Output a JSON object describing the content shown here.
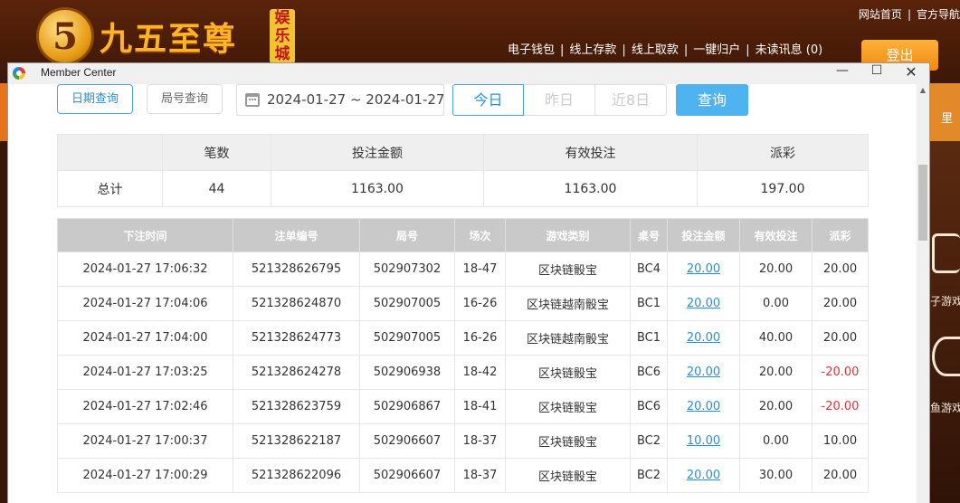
{
  "site": {
    "logo_glyph": "5",
    "logo_text": "九五至尊",
    "logo_sub": "娱乐城",
    "top_links": [
      "网站首页",
      "官方导航"
    ],
    "nav_links": [
      "电子钱包",
      "线上存款",
      "线上取款",
      "一键归户",
      "未读讯息 (0)"
    ],
    "logout_label": "登出",
    "right_labels": [
      "电子游戏",
      "捕鱼游戏"
    ],
    "right_top_text": "里"
  },
  "window": {
    "title": "Member Center",
    "controls": {
      "minimize": "—",
      "maximize": "☐",
      "close": "✕"
    }
  },
  "filter": {
    "tab_date": "日期查询",
    "tab_round": "局号查询",
    "date_range": "2024-01-27 ~ 2024-01-27",
    "quick": [
      "今日",
      "昨日",
      "近8日"
    ],
    "query_label": "查询"
  },
  "summary": {
    "headers": [
      "",
      "笔数",
      "投注金额",
      "有效投注",
      "派彩"
    ],
    "row": [
      "总计",
      "44",
      "1163.00",
      "1163.00",
      "197.00"
    ]
  },
  "bets": {
    "headers": [
      "下注时间",
      "注单编号",
      "局号",
      "场次",
      "游戏类别",
      "桌号",
      "投注金额",
      "有效投注",
      "派彩"
    ],
    "rows": [
      [
        "2024-01-27 17:06:32",
        "521328626795",
        "502907302",
        "18-47",
        "区块链骰宝",
        "BC4",
        "20.00",
        "20.00",
        "20.00"
      ],
      [
        "2024-01-27 17:04:06",
        "521328624870",
        "502907005",
        "16-26",
        "区块链越南骰宝",
        "BC1",
        "20.00",
        "0.00",
        "20.00"
      ],
      [
        "2024-01-27 17:04:00",
        "521328624773",
        "502907005",
        "16-26",
        "区块链越南骰宝",
        "BC1",
        "20.00",
        "40.00",
        "20.00"
      ],
      [
        "2024-01-27 17:03:25",
        "521328624278",
        "502906938",
        "18-42",
        "区块链骰宝",
        "BC6",
        "20.00",
        "20.00",
        "-20.00"
      ],
      [
        "2024-01-27 17:02:46",
        "521328623759",
        "502906867",
        "18-41",
        "区块链骰宝",
        "BC6",
        "20.00",
        "20.00",
        "-20.00"
      ],
      [
        "2024-01-27 17:00:37",
        "521328622187",
        "502906607",
        "18-37",
        "区块链骰宝",
        "BC2",
        "10.00",
        "0.00",
        "10.00"
      ],
      [
        "2024-01-27 17:00:29",
        "521328622096",
        "502906607",
        "18-37",
        "区块链骰宝",
        "BC2",
        "20.00",
        "30.00",
        "20.00"
      ]
    ]
  },
  "colors": {
    "accent": "#4fb3ef",
    "negative": "#e0303a",
    "link": "#2b8fd8"
  }
}
